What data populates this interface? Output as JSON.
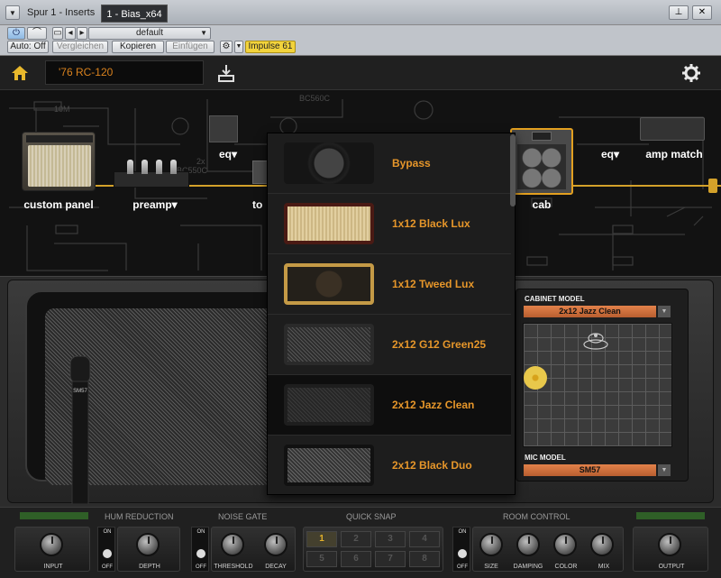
{
  "host": {
    "track_title": "Spur 1 - Inserts",
    "plugin_tab": "1 - Bias_x64",
    "preset": "default",
    "auto_label": "Auto: Off",
    "compare_label": "Vergleichen",
    "copy_label": "Kopieren",
    "paste_label": "Einfügen",
    "impulse_label": "Impulse 61"
  },
  "plugin": {
    "preset_name": "'76 RC-120",
    "chain": {
      "custom_panel": "custom panel",
      "preamp": "preamp",
      "eq": "eq",
      "to": "to",
      "cab": "cab",
      "eq2": "eq",
      "amp_match": "amp match"
    },
    "schematic_labels": {
      "r10m": "10M",
      "bc560c_top": "BC560C",
      "bc550c": "BC550C",
      "x2": "2x"
    }
  },
  "cabinet_list": [
    {
      "label": "Bypass"
    },
    {
      "label": "1x12 Black Lux"
    },
    {
      "label": "1x12 Tweed Lux"
    },
    {
      "label": "2x12 G12 Green25"
    },
    {
      "label": "2x12 Jazz Clean"
    },
    {
      "label": "2x12 Black Duo"
    }
  ],
  "cabinet_model": {
    "label": "CABINET MODEL",
    "value": "2x12 Jazz Clean"
  },
  "mic_model": {
    "label": "MIC MODEL",
    "value": "SM57"
  },
  "mic_badge": "SM57",
  "controls": {
    "hum_reduction": "HUM REDUCTION",
    "noise_gate": "NOISE GATE",
    "quick_snap": "QUICK SNAP",
    "room_control": "ROOM CONTROL",
    "input": "INPUT",
    "depth": "DEPTH",
    "threshold": "THRESHOLD",
    "decay": "DECAY",
    "size": "SIZE",
    "damping": "DAMPING",
    "color": "COLOR",
    "mix": "MIX",
    "output": "OUTPUT",
    "on": "ON",
    "off": "OFF",
    "snaps": [
      "1",
      "2",
      "3",
      "4",
      "5",
      "6",
      "7",
      "8"
    ]
  },
  "colors": {
    "accent": "#e6962a",
    "chain": "#d3a12a",
    "impulse": "#f2d33c"
  }
}
